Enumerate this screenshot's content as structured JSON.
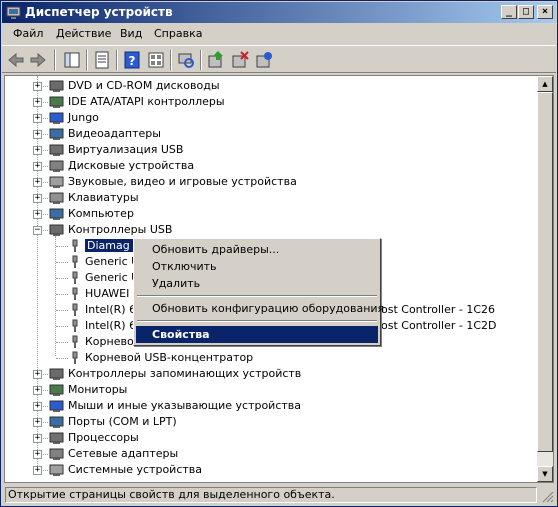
{
  "window": {
    "title": "Диспетчер устройств",
    "minimize": "_",
    "maximize": "□",
    "close": "×"
  },
  "menu": [
    "Файл",
    "Действие",
    "Вид",
    "Справка"
  ],
  "toolbar": {
    "icons": [
      "back-arrow-icon",
      "forward-arrow-icon",
      "show-hide-tree-icon",
      "properties-icon",
      "help-icon",
      "view-icon",
      "scan-hardware-icon",
      "update-driver-icon",
      "disable-device-icon",
      "uninstall-device-icon"
    ]
  },
  "tree": {
    "expander_plus": "+",
    "expander_minus": "−",
    "categories_top": [
      "DVD и CD-ROM дисководы",
      "IDE ATA/ATAPI контроллеры",
      "Jungo",
      "Видеоадаптеры",
      "Виртуализация USB",
      "Дисковые устройства",
      "Звуковые, видео и игровые устройства",
      "Клавиатуры",
      "Компьютер"
    ],
    "usb_category": "Контроллеры USB",
    "usb_children": [
      "Diamag II",
      "Generic U",
      "Generic U",
      "HUAWEI I",
      "Intel(R) 6",
      "Intel(R) 6",
      "Корневой",
      "Корневой USB-концентратор"
    ],
    "usb_children_suffix": {
      "4": "ost Controller - 1C26",
      "5": "ost Controller - 1C2D"
    },
    "categories_bottom": [
      "Контроллеры запоминающих устройств",
      "Мониторы",
      "Мыши и иные указывающие устройства",
      "Порты (COM и LPT)",
      "Процессоры",
      "Сетевые адаптеры",
      "Системные устройства"
    ]
  },
  "context_menu": {
    "items": [
      "Обновить драйверы...",
      "Отключить",
      "Удалить",
      "Обновить конфигурацию оборудования",
      "Свойства"
    ]
  },
  "status": "Открытие страницы свойств для выделенного объекта.",
  "colors": {
    "titlebar_start": "#0a246a",
    "titlebar_end": "#a6caf0",
    "selection": "#0a246a",
    "chrome": "#d4d0c8"
  }
}
